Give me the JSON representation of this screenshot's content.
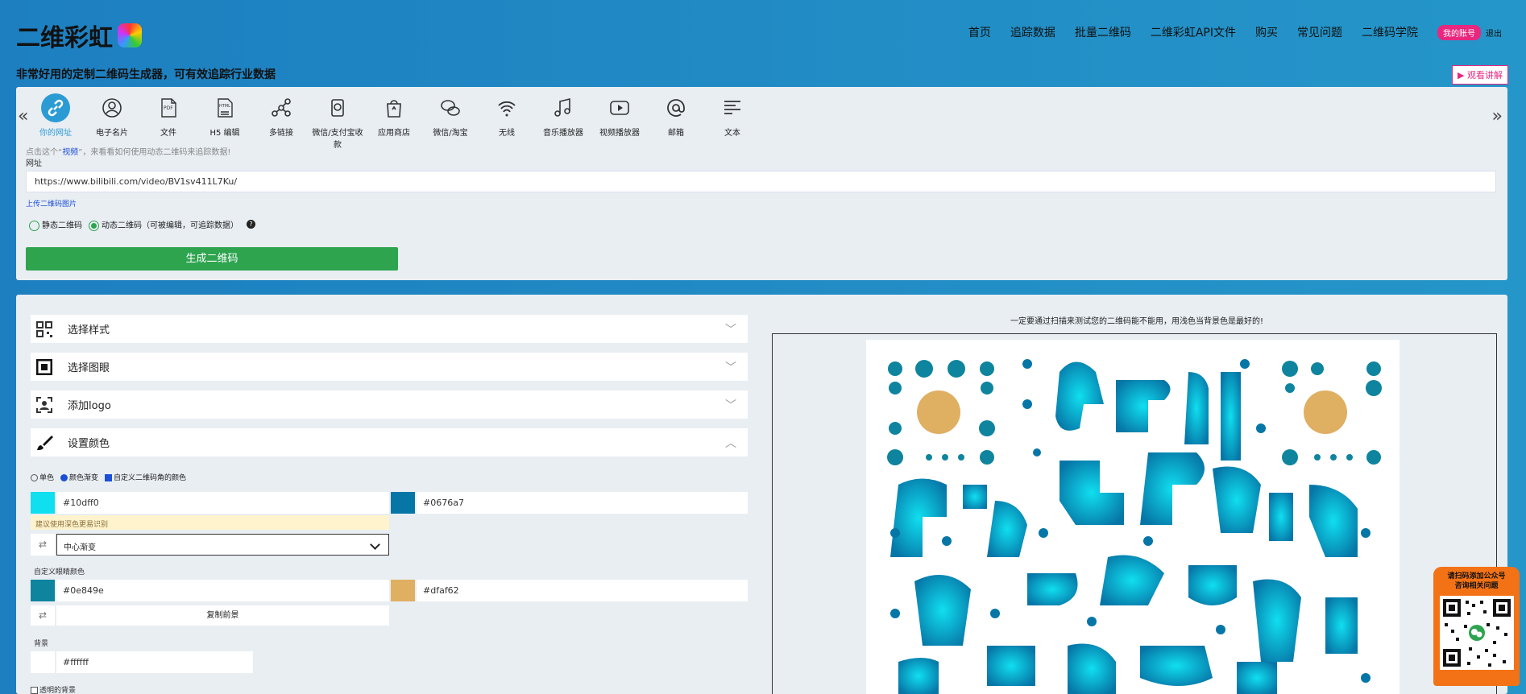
{
  "header": {
    "logo_text": "二维彩虹",
    "nav": [
      "首页",
      "追踪数据",
      "批量二维码",
      "二维彩虹API文件",
      "购买",
      "常见问题",
      "二维码学院"
    ],
    "account": "我的账号",
    "logout": "退出",
    "tagline": "非常好用的定制二维码生成器，可有效追踪行业数据",
    "watch_btn": "▶ 观看讲解"
  },
  "types": [
    {
      "label": "你的网址",
      "icon": "link-icon",
      "active": true
    },
    {
      "label": "电子名片",
      "icon": "contact-icon"
    },
    {
      "label": "文件",
      "icon": "pdf-icon"
    },
    {
      "label": "H5 编辑",
      "icon": "html-icon"
    },
    {
      "label": "多链接",
      "icon": "multi-link-icon"
    },
    {
      "label": "微信/支付宝收款",
      "icon": "payment-icon"
    },
    {
      "label": "应用商店",
      "icon": "app-store-icon"
    },
    {
      "label": "微信/淘宝",
      "icon": "wechat-taobao-icon"
    },
    {
      "label": "无线",
      "icon": "wifi-icon"
    },
    {
      "label": "音乐播放器",
      "icon": "music-icon"
    },
    {
      "label": "视频播放器",
      "icon": "video-icon"
    },
    {
      "label": "邮箱",
      "icon": "email-icon"
    },
    {
      "label": "文本",
      "icon": "text-icon"
    }
  ],
  "form": {
    "hint_pre": "点击这个“",
    "hint_link": "视频",
    "hint_post": "”，来看看如何使用动态二维码来追踪数据!",
    "url_label": "网址",
    "url_value": "https://www.bilibili.com/video/BV1sv411L7Ku/",
    "upload": "上传二维码图片",
    "static_label": "静态二维码",
    "dynamic_label": "动态二维码（可被编辑，可追踪数据）",
    "generate": "生成二维码"
  },
  "accordion": {
    "style": "选择样式",
    "eye": "选择图眼",
    "logo": "添加logo",
    "color": "设置颜色"
  },
  "colors": {
    "mode_single": "单色",
    "mode_gradient": "颜色渐变",
    "custom_eye": "自定义二维码角的颜色",
    "fg1": "#10dff0",
    "fg2": "#0676a7",
    "warn": "建议使用深色更易识别",
    "gradient_type": "中心渐变",
    "eye_label": "自定义眼睛颜色",
    "eye1": "#0e849e",
    "eye2": "#dfaf62",
    "copy": "复制前景",
    "bg_label": "背景",
    "bg": "#ffffff",
    "transparent": "透明的背景"
  },
  "preview": {
    "note": "一定要通过扫描来测试您的二维码能不能用，用浅色当背景色是最好的!"
  },
  "float": {
    "line1": "请扫码添加公众号",
    "line2": "咨询相关问题"
  }
}
